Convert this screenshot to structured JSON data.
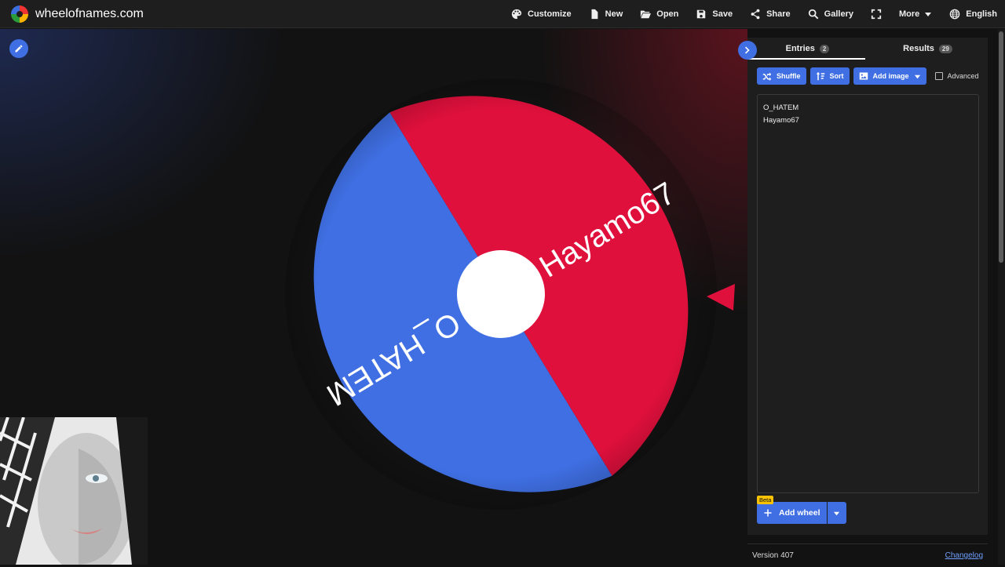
{
  "brand": {
    "name": "wheelofnames.com",
    "icon": "wheel-logo-icon"
  },
  "nav": [
    {
      "key": "customize",
      "label": "Customize",
      "icon": "palette-icon"
    },
    {
      "key": "new",
      "label": "New",
      "icon": "file-icon"
    },
    {
      "key": "open",
      "label": "Open",
      "icon": "folder-open-icon"
    },
    {
      "key": "save",
      "label": "Save",
      "icon": "floppy-icon"
    },
    {
      "key": "share",
      "label": "Share",
      "icon": "share-icon"
    },
    {
      "key": "gallery",
      "label": "Gallery",
      "icon": "search-icon"
    },
    {
      "key": "fullscreen",
      "label": "",
      "icon": "fullscreen-icon"
    },
    {
      "key": "more",
      "label": "More",
      "icon": "chevron-down-icon"
    },
    {
      "key": "language",
      "label": "English",
      "icon": "globe-icon"
    }
  ],
  "wheel": {
    "segments": [
      {
        "label": "O_HATEM",
        "color": "#3f6fe3"
      },
      {
        "label": "Hayamo67",
        "color": "#e0103c"
      }
    ],
    "hub_color": "#ffffff",
    "pointer_color": "#e0103c"
  },
  "panel": {
    "tabs": [
      {
        "label": "Entries",
        "count": "2",
        "active": true
      },
      {
        "label": "Results",
        "count": "29",
        "active": false
      }
    ],
    "toolbar": {
      "shuffle": "Shuffle",
      "sort": "Sort",
      "add_image": "Add image",
      "advanced": "Advanced"
    },
    "entries": [
      "O_HATEM",
      "Hayamo67"
    ],
    "add_wheel": {
      "label": "Add wheel",
      "badge": "Beta"
    },
    "footer": {
      "version": "Version 407",
      "changelog": "Changelog"
    }
  },
  "colors": {
    "accent": "#3f6fe3",
    "background": "#121212",
    "surface": "#1e1e1e"
  }
}
